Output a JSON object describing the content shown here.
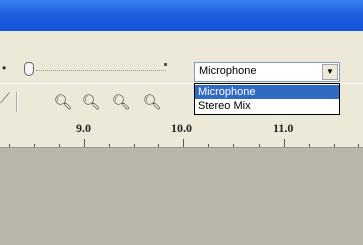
{
  "audio_source": {
    "selected": "Microphone",
    "options": [
      "Microphone",
      "Stereo Mix"
    ],
    "highlighted_index": 0
  },
  "ruler": {
    "labels": [
      "9.0",
      "10.0",
      "11.0"
    ]
  },
  "colors": {
    "titlebar": "#1d5fe0",
    "toolbar": "#ece9d8",
    "selection": "#316ac5",
    "track_area": "#bbb6aa"
  },
  "icons": {
    "input_meter": "microphone-icon",
    "tools": [
      "zoom-in-icon",
      "zoom-out-icon",
      "fit-selection-icon",
      "fit-project-icon"
    ]
  }
}
